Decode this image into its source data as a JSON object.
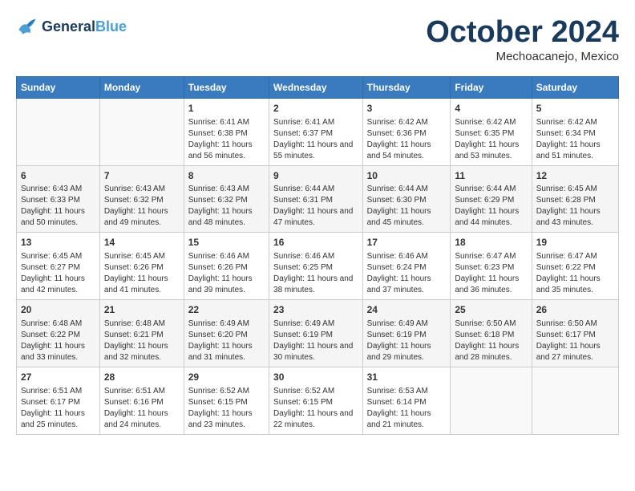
{
  "header": {
    "logo_line1": "General",
    "logo_line2": "Blue",
    "month": "October 2024",
    "location": "Mechoacanejo, Mexico"
  },
  "days_of_week": [
    "Sunday",
    "Monday",
    "Tuesday",
    "Wednesday",
    "Thursday",
    "Friday",
    "Saturday"
  ],
  "weeks": [
    [
      {
        "day": "",
        "content": ""
      },
      {
        "day": "",
        "content": ""
      },
      {
        "day": "1",
        "content": "Sunrise: 6:41 AM\nSunset: 6:38 PM\nDaylight: 11 hours and 56 minutes."
      },
      {
        "day": "2",
        "content": "Sunrise: 6:41 AM\nSunset: 6:37 PM\nDaylight: 11 hours and 55 minutes."
      },
      {
        "day": "3",
        "content": "Sunrise: 6:42 AM\nSunset: 6:36 PM\nDaylight: 11 hours and 54 minutes."
      },
      {
        "day": "4",
        "content": "Sunrise: 6:42 AM\nSunset: 6:35 PM\nDaylight: 11 hours and 53 minutes."
      },
      {
        "day": "5",
        "content": "Sunrise: 6:42 AM\nSunset: 6:34 PM\nDaylight: 11 hours and 51 minutes."
      }
    ],
    [
      {
        "day": "6",
        "content": "Sunrise: 6:43 AM\nSunset: 6:33 PM\nDaylight: 11 hours and 50 minutes."
      },
      {
        "day": "7",
        "content": "Sunrise: 6:43 AM\nSunset: 6:32 PM\nDaylight: 11 hours and 49 minutes."
      },
      {
        "day": "8",
        "content": "Sunrise: 6:43 AM\nSunset: 6:32 PM\nDaylight: 11 hours and 48 minutes."
      },
      {
        "day": "9",
        "content": "Sunrise: 6:44 AM\nSunset: 6:31 PM\nDaylight: 11 hours and 47 minutes."
      },
      {
        "day": "10",
        "content": "Sunrise: 6:44 AM\nSunset: 6:30 PM\nDaylight: 11 hours and 45 minutes."
      },
      {
        "day": "11",
        "content": "Sunrise: 6:44 AM\nSunset: 6:29 PM\nDaylight: 11 hours and 44 minutes."
      },
      {
        "day": "12",
        "content": "Sunrise: 6:45 AM\nSunset: 6:28 PM\nDaylight: 11 hours and 43 minutes."
      }
    ],
    [
      {
        "day": "13",
        "content": "Sunrise: 6:45 AM\nSunset: 6:27 PM\nDaylight: 11 hours and 42 minutes."
      },
      {
        "day": "14",
        "content": "Sunrise: 6:45 AM\nSunset: 6:26 PM\nDaylight: 11 hours and 41 minutes."
      },
      {
        "day": "15",
        "content": "Sunrise: 6:46 AM\nSunset: 6:26 PM\nDaylight: 11 hours and 39 minutes."
      },
      {
        "day": "16",
        "content": "Sunrise: 6:46 AM\nSunset: 6:25 PM\nDaylight: 11 hours and 38 minutes."
      },
      {
        "day": "17",
        "content": "Sunrise: 6:46 AM\nSunset: 6:24 PM\nDaylight: 11 hours and 37 minutes."
      },
      {
        "day": "18",
        "content": "Sunrise: 6:47 AM\nSunset: 6:23 PM\nDaylight: 11 hours and 36 minutes."
      },
      {
        "day": "19",
        "content": "Sunrise: 6:47 AM\nSunset: 6:22 PM\nDaylight: 11 hours and 35 minutes."
      }
    ],
    [
      {
        "day": "20",
        "content": "Sunrise: 6:48 AM\nSunset: 6:22 PM\nDaylight: 11 hours and 33 minutes."
      },
      {
        "day": "21",
        "content": "Sunrise: 6:48 AM\nSunset: 6:21 PM\nDaylight: 11 hours and 32 minutes."
      },
      {
        "day": "22",
        "content": "Sunrise: 6:49 AM\nSunset: 6:20 PM\nDaylight: 11 hours and 31 minutes."
      },
      {
        "day": "23",
        "content": "Sunrise: 6:49 AM\nSunset: 6:19 PM\nDaylight: 11 hours and 30 minutes."
      },
      {
        "day": "24",
        "content": "Sunrise: 6:49 AM\nSunset: 6:19 PM\nDaylight: 11 hours and 29 minutes."
      },
      {
        "day": "25",
        "content": "Sunrise: 6:50 AM\nSunset: 6:18 PM\nDaylight: 11 hours and 28 minutes."
      },
      {
        "day": "26",
        "content": "Sunrise: 6:50 AM\nSunset: 6:17 PM\nDaylight: 11 hours and 27 minutes."
      }
    ],
    [
      {
        "day": "27",
        "content": "Sunrise: 6:51 AM\nSunset: 6:17 PM\nDaylight: 11 hours and 25 minutes."
      },
      {
        "day": "28",
        "content": "Sunrise: 6:51 AM\nSunset: 6:16 PM\nDaylight: 11 hours and 24 minutes."
      },
      {
        "day": "29",
        "content": "Sunrise: 6:52 AM\nSunset: 6:15 PM\nDaylight: 11 hours and 23 minutes."
      },
      {
        "day": "30",
        "content": "Sunrise: 6:52 AM\nSunset: 6:15 PM\nDaylight: 11 hours and 22 minutes."
      },
      {
        "day": "31",
        "content": "Sunrise: 6:53 AM\nSunset: 6:14 PM\nDaylight: 11 hours and 21 minutes."
      },
      {
        "day": "",
        "content": ""
      },
      {
        "day": "",
        "content": ""
      }
    ]
  ]
}
